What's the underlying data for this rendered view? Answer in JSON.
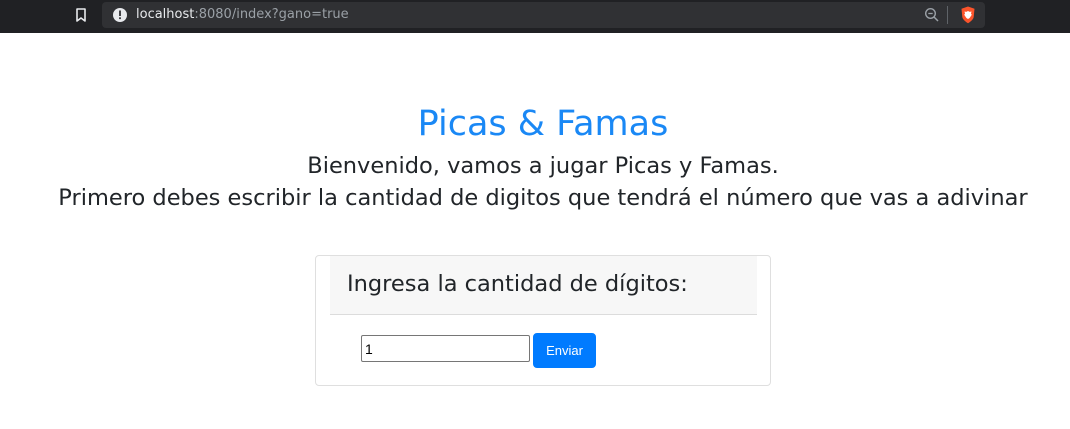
{
  "browser": {
    "url_host": "localhost",
    "url_rest": ":8080/index?gano=true",
    "icons": [
      "bookmark-icon",
      "site-info-icon",
      "zoom-icon",
      "brave-shield-icon"
    ],
    "colors": {
      "bar": "#202124",
      "urlbar": "#303134",
      "brave": "#fb542b"
    }
  },
  "page": {
    "title": "Picas & Famas",
    "subtitle_line1": "Bienvenido, vamos a jugar Picas y Famas.",
    "subtitle_line2": "Primero debes escribir la cantidad de digitos que tendrá el número que vas a adivinar",
    "colors": {
      "title": "#1a88f5",
      "button": "#007bff"
    }
  },
  "form": {
    "header": "Ingresa la cantidad de dígitos:",
    "input_value": "1",
    "submit_label": "Enviar"
  }
}
